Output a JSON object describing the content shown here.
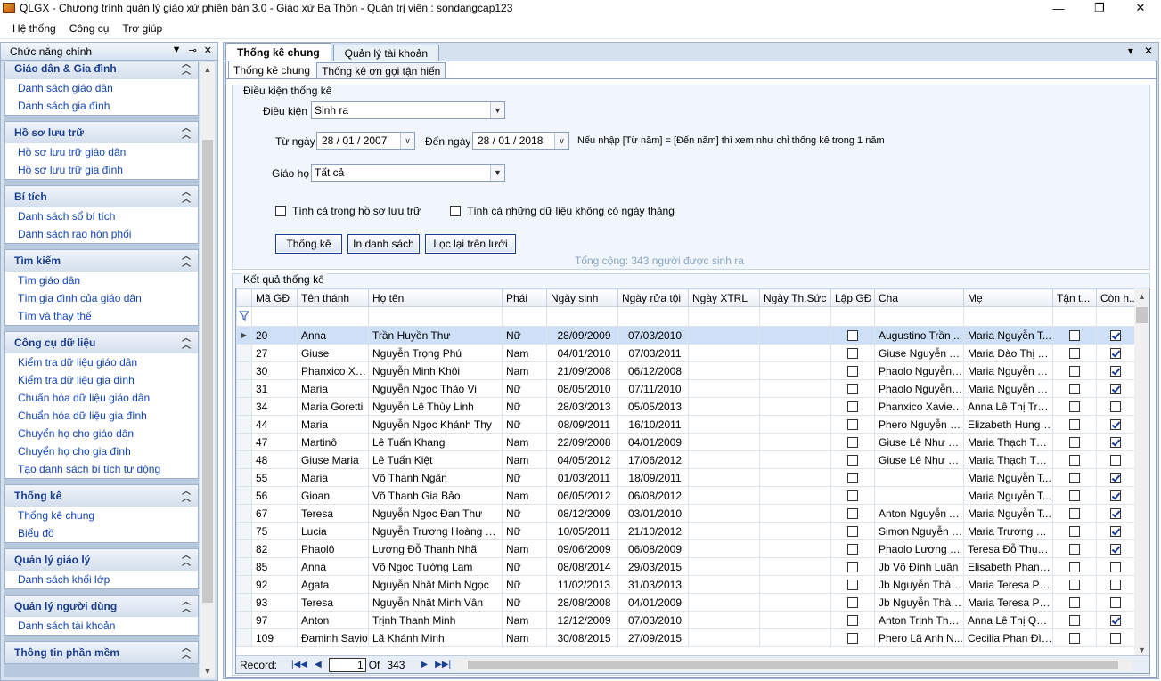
{
  "window": {
    "title": "QLGX - Chương trình quản lý giáo xứ phiên bản 3.0 - Giáo xứ Ba Thôn - Quản trị viên : sondangcap123"
  },
  "menu": [
    "Hệ thống",
    "Công cụ",
    "Trợ giúp"
  ],
  "left_panel": {
    "title": "Chức năng chính",
    "groups": [
      {
        "title": "Giáo dân & Gia đình",
        "items": [
          "Danh sách giáo dân",
          "Danh sách gia đình"
        ]
      },
      {
        "title": "Hồ sơ lưu trữ",
        "items": [
          "Hồ sơ lưu trữ giáo dân",
          "Hồ sơ lưu trữ gia đình"
        ]
      },
      {
        "title": "Bí tích",
        "items": [
          "Danh sách sổ bí tích",
          "Danh sách rao hôn phối"
        ]
      },
      {
        "title": "Tìm kiếm",
        "items": [
          "Tìm giáo dân",
          "Tìm gia đình của giáo dân",
          "Tìm và thay thế"
        ]
      },
      {
        "title": "Công cụ dữ liệu",
        "items": [
          "Kiểm tra dữ liệu giáo dân",
          "Kiểm tra dữ liệu gia đình",
          "Chuẩn hóa dữ liệu giáo dân",
          "Chuẩn hóa dữ liệu gia đình",
          "Chuyển họ cho giáo dân",
          "Chuyển họ cho gia đình",
          "Tạo danh sách bí tích tự động"
        ]
      },
      {
        "title": "Thống kê",
        "items": [
          "Thống kê chung",
          "Biểu đồ"
        ]
      },
      {
        "title": "Quản lý giáo lý",
        "items": [
          "Danh sách khối lớp"
        ]
      },
      {
        "title": "Quản lý người dùng",
        "items": [
          "Danh sách tài khoản"
        ]
      },
      {
        "title": "Thông tin phần mềm",
        "items": []
      }
    ]
  },
  "tabs": [
    "Thống kê chung",
    "Quản lý tài khoản"
  ],
  "subtabs": [
    "Thống kê chung",
    "Thống kê ơn gọi tận hiến"
  ],
  "conditions": {
    "legend": "Điều kiện thống kê",
    "condition_label": "Điều kiện",
    "condition_value": "Sinh ra",
    "from_label": "Từ ngày",
    "from_value": "28 / 01 / 2007",
    "to_label": "Đến ngày",
    "to_value": "28 / 01 / 2018",
    "note": "Nếu nhập [Từ năm] = [Đến năm] thì xem như chỉ thống kê trong 1 năm",
    "parish_label": "Giáo họ",
    "parish_value": "Tất cả",
    "chk_archive": "Tính cả trong hồ sơ lưu trữ",
    "chk_nodate": "Tính cả những dữ liệu không có ngày tháng",
    "btn_stats": "Thống kê",
    "btn_print": "In danh sách",
    "btn_filter": "Lọc lại trên lưới",
    "total": "Tổng cộng: 343 người được sinh ra"
  },
  "results": {
    "legend": "Kết quả thống kê",
    "columns": [
      "Mã GĐ",
      "Tên thánh",
      "Họ tên",
      "Phái",
      "Ngày sinh",
      "Ngày rửa tội",
      "Ngày XTRL",
      "Ngày Th.Sức",
      "Lập GĐ",
      "Cha",
      "Mẹ",
      "Tận t...",
      "Còn h..."
    ],
    "rows": [
      [
        "20",
        "Anna",
        "Trần Huyền Thư",
        "Nữ",
        "28/09/2009",
        "07/03/2010",
        "",
        "",
        false,
        "Augustino Trần ...",
        "Maria Nguyễn T...",
        false,
        true
      ],
      [
        "27",
        "Giuse",
        "Nguyễn Trọng Phú",
        "Nam",
        "04/01/2010",
        "07/03/2011",
        "",
        "",
        false,
        "Giuse Nguyễn Tr...",
        "Maria Đào Thị H...",
        false,
        true
      ],
      [
        "30",
        "Phanxico Xa...",
        "Nguyễn Minh Khôi",
        "Nam",
        "21/09/2008",
        "06/12/2008",
        "",
        "",
        false,
        "Phaolo Nguyễn ...",
        "Maria Nguyễn N...",
        false,
        true
      ],
      [
        "31",
        "Maria",
        "Nguyễn Ngọc Thảo Vi",
        "Nữ",
        "08/05/2010",
        "07/11/2010",
        "",
        "",
        false,
        "Phaolo Nguyễn ...",
        "Maria Nguyễn N...",
        false,
        true
      ],
      [
        "34",
        "Maria Goretti",
        "Nguyễn Lê Thùy Linh",
        "Nữ",
        "28/03/2013",
        "05/05/2013",
        "",
        "",
        false,
        "Phanxico Xavie ...",
        "Anna Lê Thị Trầ...",
        false,
        false
      ],
      [
        "44",
        "Maria",
        "Nguyễn Ngọc Khánh Thy",
        "Nữ",
        "08/09/2011",
        "16/10/2011",
        "",
        "",
        false,
        "Phero Nguyễn M...",
        "Elizabeth Hungar...",
        false,
        true
      ],
      [
        "47",
        "Martinô",
        "Lê Tuấn Khang",
        "Nam",
        "22/09/2008",
        "04/01/2009",
        "",
        "",
        false,
        "Giuse Lê Như Khôi",
        "Maria Thạch Thị ...",
        false,
        true
      ],
      [
        "48",
        "Giuse Maria",
        "Lê Tuấn Kiệt",
        "Nam",
        "04/05/2012",
        "17/06/2012",
        "",
        "",
        false,
        "Giuse Lê Như Khôi",
        "Maria Thạch Thị ...",
        false,
        false
      ],
      [
        "55",
        "Maria",
        "Võ Thanh Ngân",
        "Nữ",
        "01/03/2011",
        "18/09/2011",
        "",
        "",
        false,
        "",
        "Maria Nguyễn T...",
        false,
        true
      ],
      [
        "56",
        "Gioan",
        "Võ Thanh Gia Bảo",
        "Nam",
        "06/05/2012",
        "06/08/2012",
        "",
        "",
        false,
        "",
        "Maria Nguyễn T...",
        false,
        true
      ],
      [
        "67",
        "Teresa",
        "Nguyễn Ngọc Đan Thư",
        "Nữ",
        "08/12/2009",
        "03/01/2010",
        "",
        "",
        false,
        "Anton Nguyễn A...",
        "Maria Nguyễn T...",
        false,
        true
      ],
      [
        "75",
        "Lucia",
        "Nguyễn Trương Hoàng Kim",
        "Nữ",
        "10/05/2011",
        "21/10/2012",
        "",
        "",
        false,
        "Simon Nguyễn H...",
        "Maria Trương Ng...",
        false,
        true
      ],
      [
        "82",
        "Phaolô",
        "Lương Đỗ Thanh Nhã",
        "Nam",
        "09/06/2009",
        "06/08/2009",
        "",
        "",
        false,
        "Phaolo Lương T...",
        "Teresa Đỗ Thụy ...",
        false,
        true
      ],
      [
        "85",
        "Anna",
        "Võ Ngọc Tường Lam",
        "Nữ",
        "08/08/2014",
        "29/03/2015",
        "",
        "",
        false,
        "Jb Võ Đình Luân",
        "Elisabeth Phan T...",
        false,
        false
      ],
      [
        "92",
        "Agata",
        "Nguyễn Nhật Minh Ngọc",
        "Nữ",
        "11/02/2013",
        "31/03/2013",
        "",
        "",
        false,
        "Jb Nguyễn Thàn...",
        "Maria Teresa Ph...",
        false,
        false
      ],
      [
        "93",
        "Teresa",
        "Nguyễn Nhật Minh Vân",
        "Nữ",
        "28/08/2008",
        "04/01/2009",
        "",
        "",
        false,
        "Jb Nguyễn Thàn...",
        "Maria Teresa Ph...",
        false,
        false
      ],
      [
        "97",
        "Anton",
        "Trịnh Thanh Minh",
        "Nam",
        "12/12/2009",
        "07/03/2010",
        "",
        "",
        false,
        "Anton Trịnh Tha...",
        "Anna Lê Thị Quỳ...",
        false,
        true
      ],
      [
        "109",
        "Đaminh Savio",
        "Lã Khánh Minh",
        "Nam",
        "30/08/2015",
        "27/09/2015",
        "",
        "",
        false,
        "Phero Lã Anh N...",
        "Cecilia Phan Đìn...",
        false,
        false
      ]
    ],
    "nav": {
      "label": "Record:",
      "current": "1",
      "of_label": "Of",
      "total": "343"
    }
  }
}
